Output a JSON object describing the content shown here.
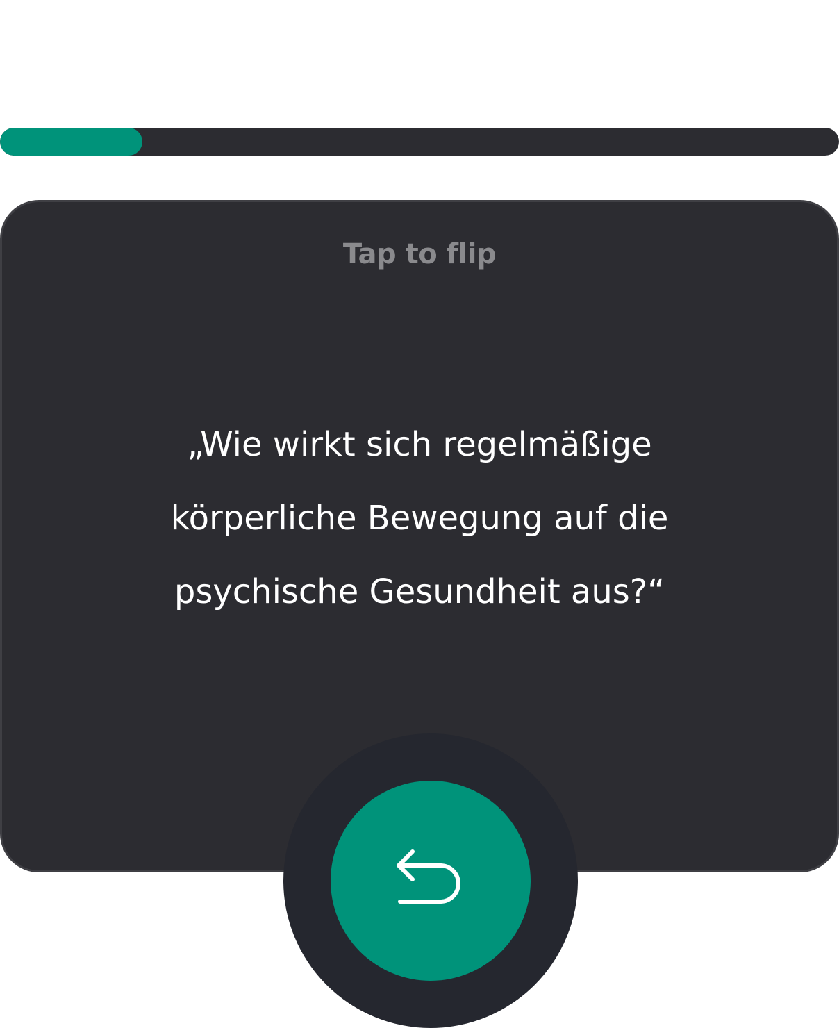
{
  "progress": {
    "value": 0.17,
    "colors": {
      "fill": "#00937a",
      "track": "#2c2c31"
    }
  },
  "card": {
    "hint": "Tap to flip",
    "question": "„Wie wirkt sich regelmäßige körperliche Bewegung auf die psychische Gesundheit aus?“",
    "background": "#2c2c31"
  },
  "flip_button": {
    "icon": "undo-arrow-icon",
    "color": "#00937a"
  }
}
